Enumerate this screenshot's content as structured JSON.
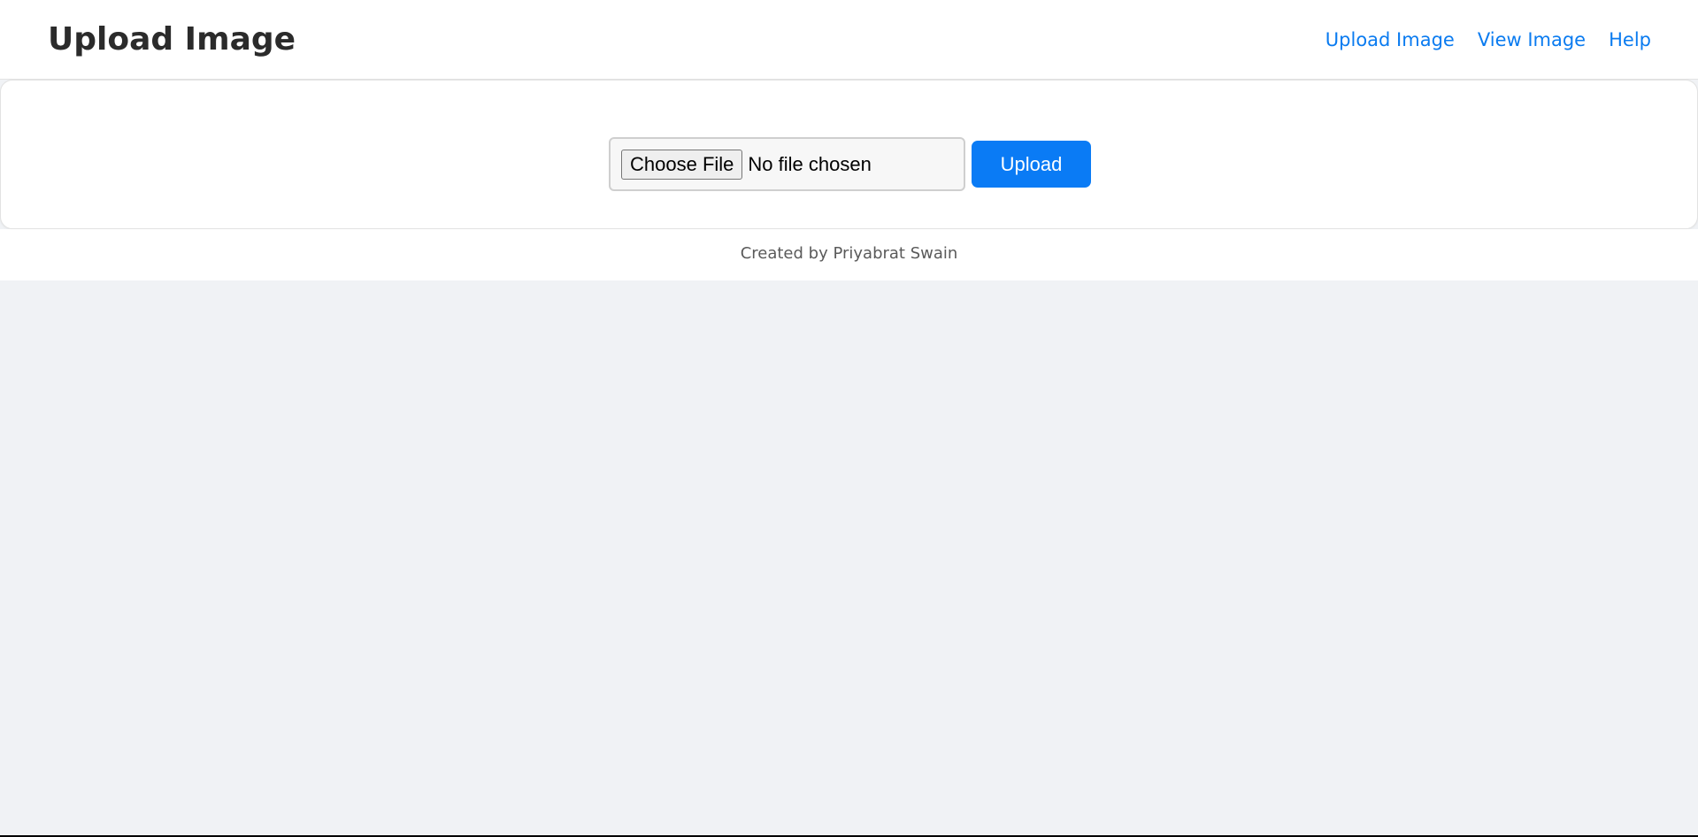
{
  "header": {
    "title": "Upload Image",
    "nav": [
      {
        "label": "Upload Image"
      },
      {
        "label": "View Image"
      },
      {
        "label": "Help"
      }
    ]
  },
  "upload_form": {
    "choose_file_label": "Choose File",
    "file_status": "No file chosen",
    "upload_label": "Upload"
  },
  "footer": {
    "text": "Created by Priyabrat Swain"
  },
  "colors": {
    "accent": "#0a7bf5",
    "page_background": "#f0f2f5",
    "title": "#2b2b2b"
  }
}
